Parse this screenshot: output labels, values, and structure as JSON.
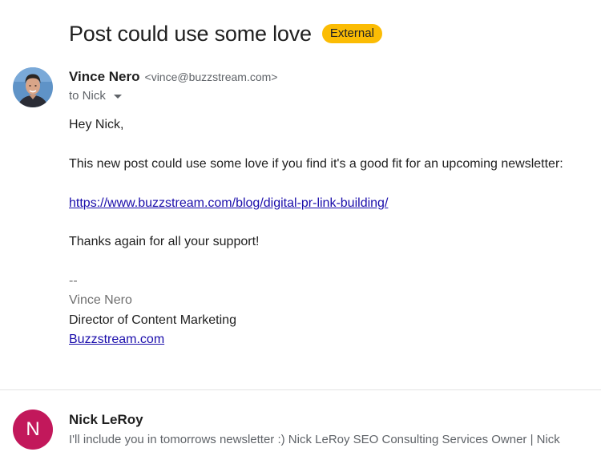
{
  "email": {
    "subject": "Post could use some love",
    "badge": "External",
    "badge_color": "#fbbc04",
    "sender": {
      "name": "Vince Nero",
      "email": "<vince@buzzstream.com>",
      "avatar_icon": "person-photo-avatar"
    },
    "recipient_label": "to Nick",
    "body": {
      "greeting": "Hey Nick,",
      "paragraph": "This new post could use some love if you find it's a good fit for an upcoming newsletter:",
      "link": "https://www.buzzstream.com/blog/digital-pr-link-building/",
      "closing": "Thanks again for all your support!",
      "signature_separator": "--",
      "signature_name": "Vince Nero",
      "signature_title": "Director of Content Marketing",
      "signature_link": "Buzzstream.com"
    }
  },
  "reply": {
    "avatar_letter": "N",
    "avatar_color": "#c2185b",
    "name": "Nick LeRoy",
    "snippet": "I'll include you in tomorrows newsletter :) Nick LeRoy SEO Consulting Services Owner | Nick"
  },
  "colors": {
    "link": "#1a0dab",
    "accent_badge": "#fbbc04"
  }
}
